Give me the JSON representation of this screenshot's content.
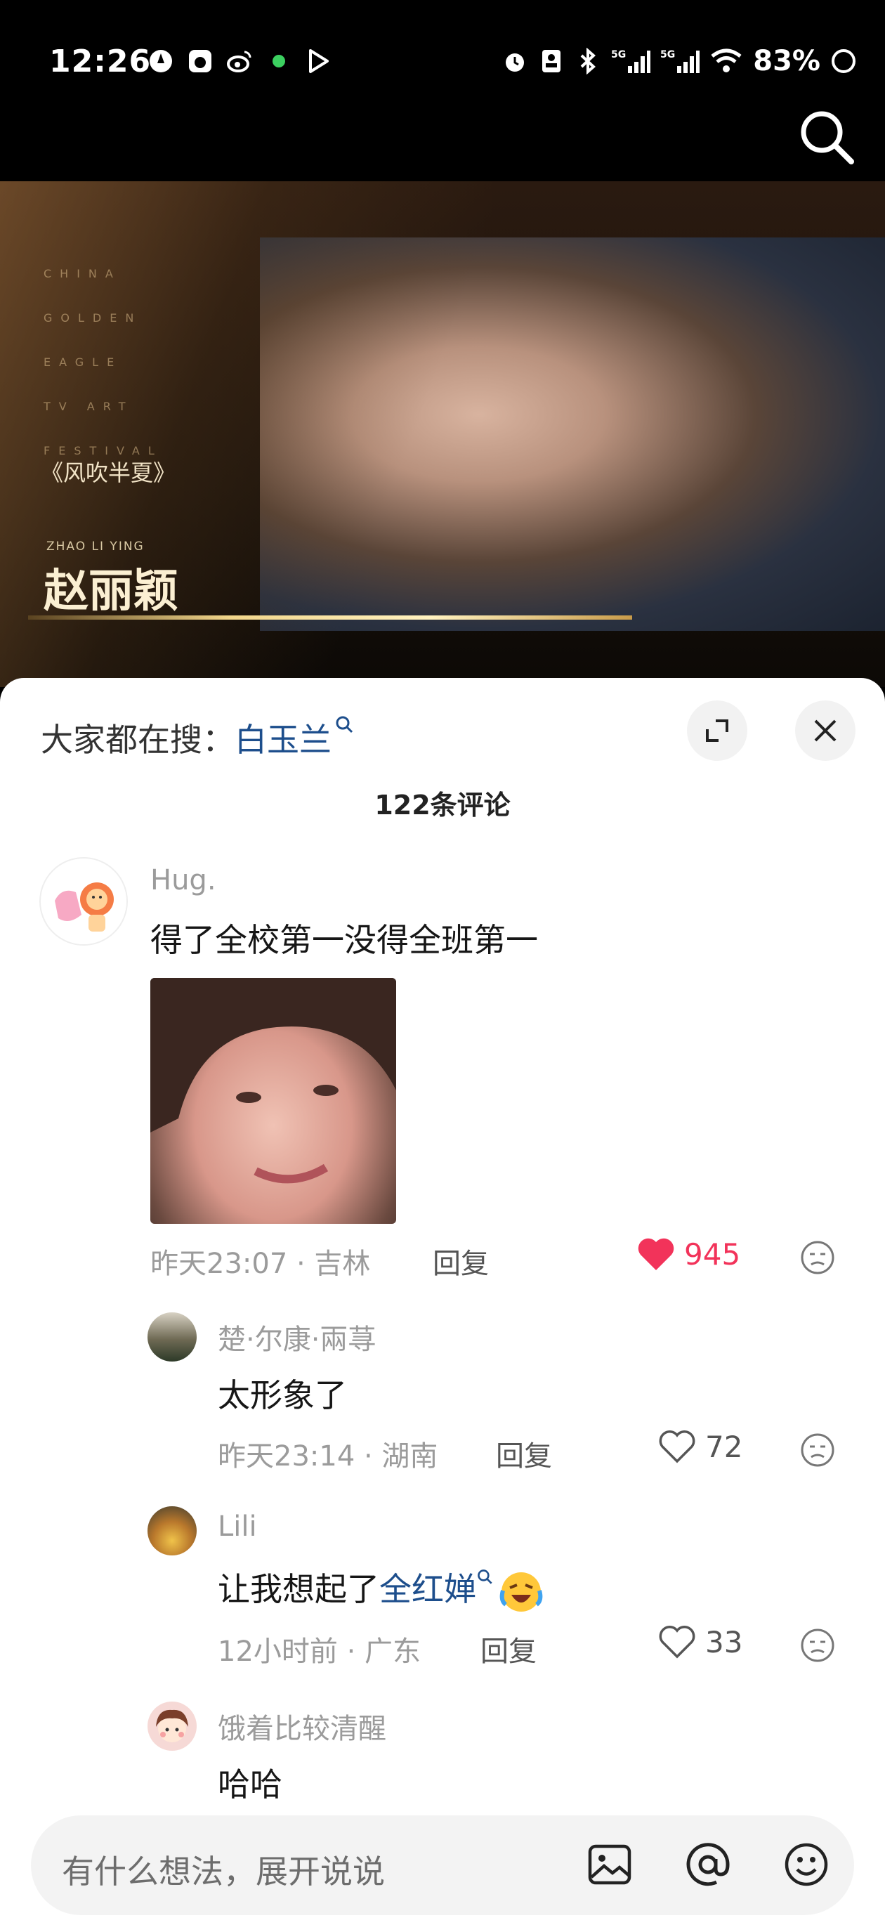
{
  "status_bar": {
    "time": "12:26",
    "battery": "83%",
    "signal1": "5G",
    "signal2": "5G"
  },
  "video": {
    "festival_lines": [
      "CHINA",
      "GOLDEN",
      "EAGLE",
      "TV ART",
      "FESTIVAL"
    ],
    "show_title": "《风吹半夏》",
    "name_en": "ZHAO LI YING",
    "name_cn": "赵丽颖"
  },
  "sheet": {
    "trending_label": "大家都在搜：",
    "trending_term": "白玉兰",
    "comment_count": "122条评论"
  },
  "comments": [
    {
      "username": "Hug.",
      "text": "得了全校第一没得全班第一",
      "time_loc": "昨天23:07 · 吉林",
      "reply": "回复",
      "likes": "945",
      "liked": true
    },
    {
      "username": "楚·尔康·兩荨",
      "text": "太形象了",
      "time_loc": "昨天23:14 · 湖南",
      "reply": "回复",
      "likes": "72",
      "liked": false
    },
    {
      "username": "Lili",
      "text_prefix": "让我想起了",
      "mention": "全红婵",
      "time_loc": "12小时前 · 广东",
      "reply": "回复",
      "likes": "33",
      "liked": false
    },
    {
      "username": "饿着比较清醒",
      "text": "哈哈"
    }
  ],
  "input": {
    "placeholder": "有什么想法，展开说说"
  },
  "colors": {
    "like_active": "#f2335a",
    "link": "#1d4e8c"
  }
}
